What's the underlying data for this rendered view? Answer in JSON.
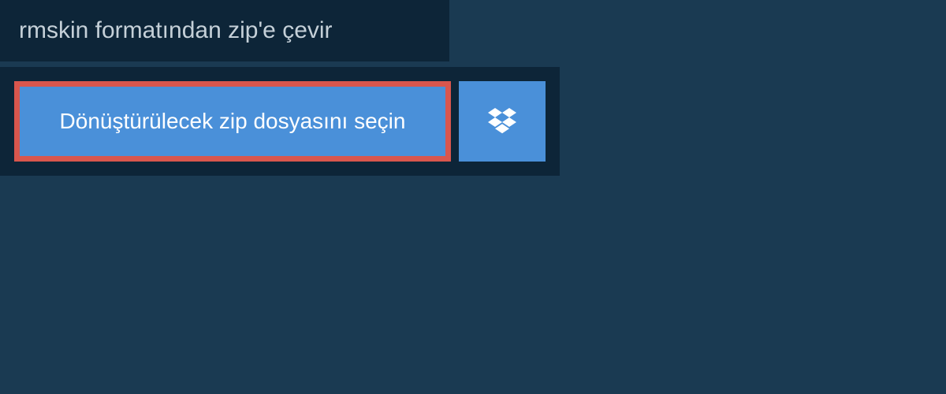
{
  "header": {
    "title": "rmskin formatından zip'e çevir"
  },
  "actions": {
    "select_file_label": "Dönüştürülecek zip dosyasını seçin",
    "dropbox_icon": "dropbox"
  },
  "colors": {
    "background": "#1a3a52",
    "panel": "#0d2538",
    "button": "#4a90d9",
    "highlight_border": "#d9564d"
  }
}
